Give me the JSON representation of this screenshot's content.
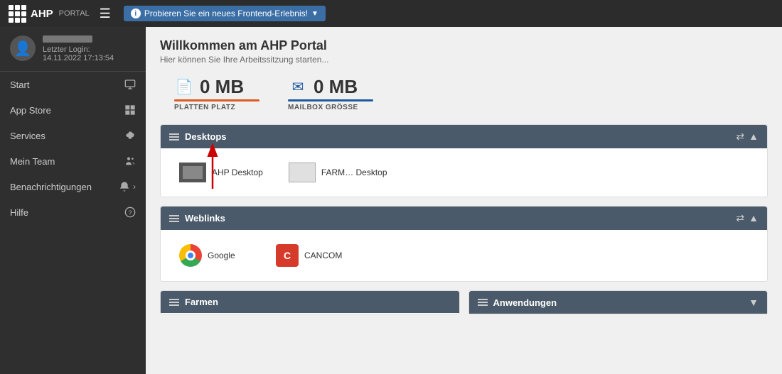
{
  "topbar": {
    "logo_text": "AHP",
    "portal_label": "PORTAL",
    "banner_text": "Probieren Sie ein neues Frontend-Erlebnis!",
    "banner_icon": "i"
  },
  "sidebar": {
    "user": {
      "login_label": "Letzter Login:",
      "login_date": "14.11.2022 17:13:54"
    },
    "nav": [
      {
        "label": "Start",
        "icon": "monitor"
      },
      {
        "label": "App Store",
        "icon": "grid"
      },
      {
        "label": "Services",
        "icon": "gear"
      },
      {
        "label": "Mein Team",
        "icon": "users"
      },
      {
        "label": "Benachrichtigungen",
        "icon": "bell",
        "has_arrow": true
      },
      {
        "label": "Hilfe",
        "icon": "question"
      }
    ]
  },
  "main": {
    "welcome_title": "Willkommen am AHP Portal",
    "welcome_sub": "Hier können Sie Ihre Arbeitssitzung starten...",
    "stats": [
      {
        "value": "0 MB",
        "label": "PLATTEN PLATZ",
        "color": "orange",
        "icon": "📄"
      },
      {
        "value": "0 MB",
        "label": "MAILBOX GRÖSSE",
        "color": "blue",
        "icon": "✉"
      }
    ],
    "desktops_section": {
      "title": "Desktops",
      "desktops": [
        {
          "name": "AHP Desktop",
          "active": true
        },
        {
          "name": "FARM… Desktop",
          "active": false
        }
      ]
    },
    "weblinks_section": {
      "title": "Weblinks",
      "links": [
        {
          "name": "Google",
          "type": "chrome"
        },
        {
          "name": "CANCOM",
          "type": "cancom"
        }
      ]
    },
    "farmen_section": {
      "title": "Farmen"
    },
    "anwendungen_section": {
      "title": "Anwendungen"
    }
  }
}
